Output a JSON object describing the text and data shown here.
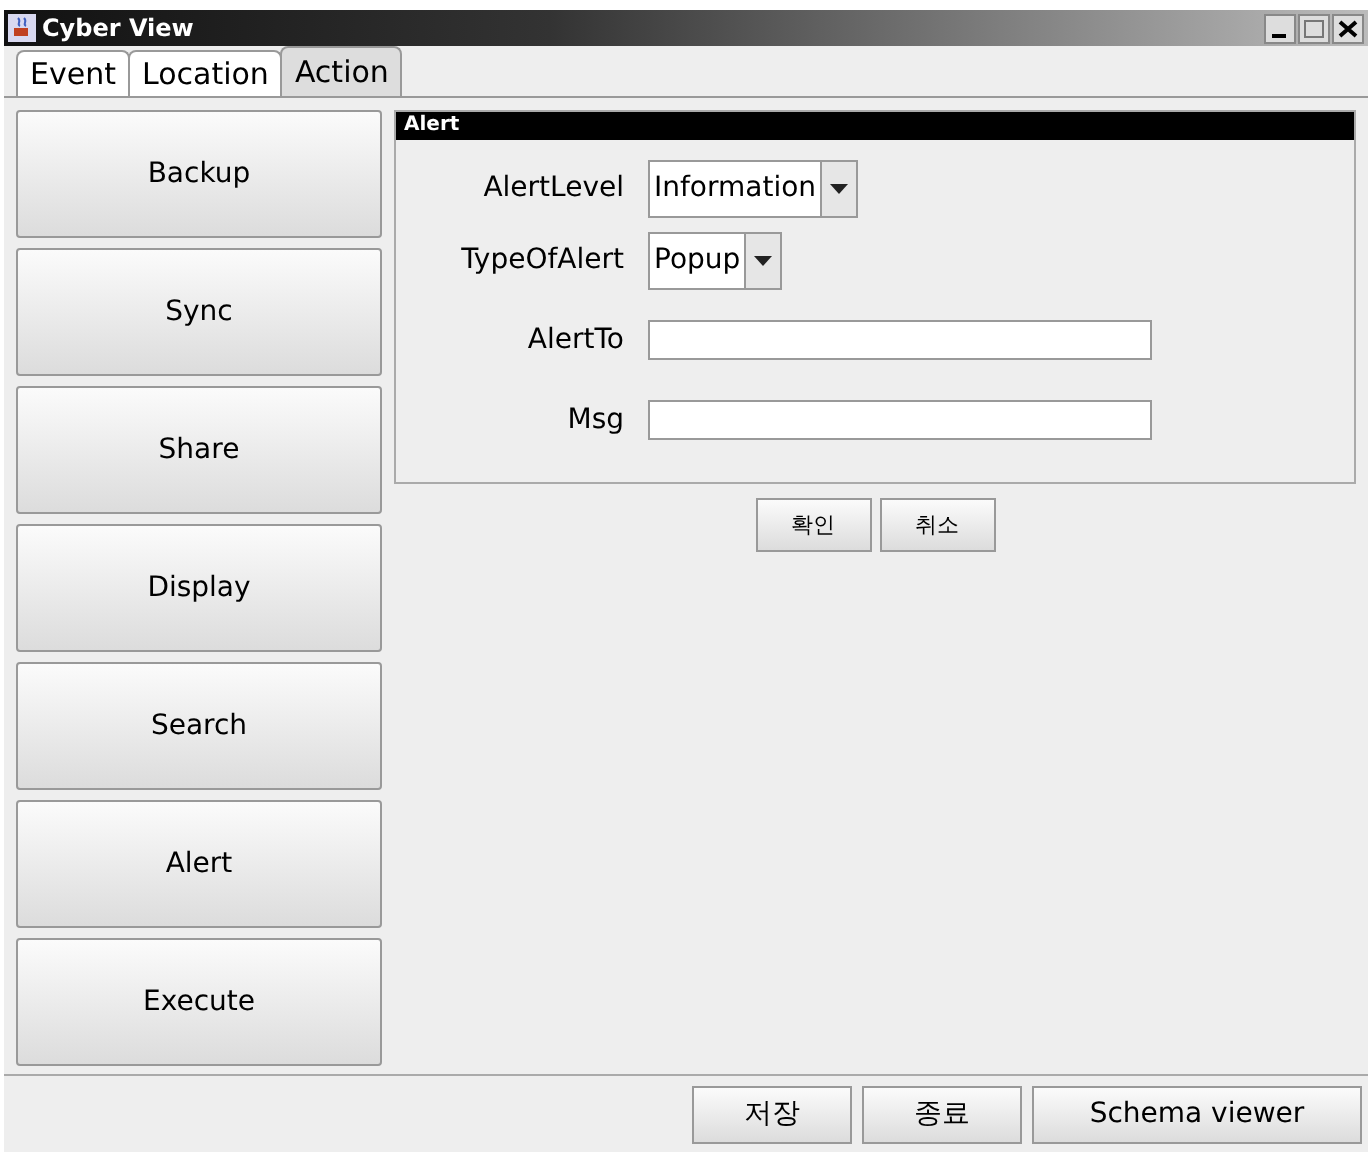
{
  "window": {
    "title": "Cyber View"
  },
  "tabs": [
    {
      "label": "Event",
      "selected": false
    },
    {
      "label": "Location",
      "selected": false
    },
    {
      "label": "Action",
      "selected": true
    }
  ],
  "actions": [
    {
      "label": "Backup"
    },
    {
      "label": "Sync"
    },
    {
      "label": "Share"
    },
    {
      "label": "Display"
    },
    {
      "label": "Search"
    },
    {
      "label": "Alert"
    },
    {
      "label": "Execute"
    }
  ],
  "panel": {
    "title": "Alert",
    "fields": [
      {
        "kind": "combo",
        "label": "AlertLevel",
        "value": "Information"
      },
      {
        "kind": "combo",
        "label": "TypeOfAlert",
        "value": "Popup"
      },
      {
        "kind": "text",
        "label": "AlertTo"
      },
      {
        "kind": "text",
        "label": "Msg"
      }
    ],
    "buttons": [
      "확인",
      "취소"
    ]
  },
  "footer_buttons": [
    "저장",
    "종료",
    "Schema viewer"
  ]
}
